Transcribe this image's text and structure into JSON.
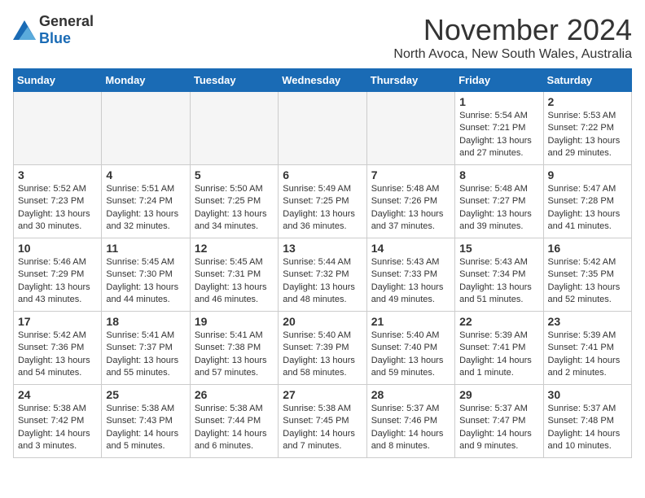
{
  "logo": {
    "text_general": "General",
    "text_blue": "Blue"
  },
  "header": {
    "month": "November 2024",
    "location": "North Avoca, New South Wales, Australia"
  },
  "weekdays": [
    "Sunday",
    "Monday",
    "Tuesday",
    "Wednesday",
    "Thursday",
    "Friday",
    "Saturday"
  ],
  "weeks": [
    [
      {
        "day": "",
        "info": ""
      },
      {
        "day": "",
        "info": ""
      },
      {
        "day": "",
        "info": ""
      },
      {
        "day": "",
        "info": ""
      },
      {
        "day": "",
        "info": ""
      },
      {
        "day": "1",
        "info": "Sunrise: 5:54 AM\nSunset: 7:21 PM\nDaylight: 13 hours and 27 minutes."
      },
      {
        "day": "2",
        "info": "Sunrise: 5:53 AM\nSunset: 7:22 PM\nDaylight: 13 hours and 29 minutes."
      }
    ],
    [
      {
        "day": "3",
        "info": "Sunrise: 5:52 AM\nSunset: 7:23 PM\nDaylight: 13 hours and 30 minutes."
      },
      {
        "day": "4",
        "info": "Sunrise: 5:51 AM\nSunset: 7:24 PM\nDaylight: 13 hours and 32 minutes."
      },
      {
        "day": "5",
        "info": "Sunrise: 5:50 AM\nSunset: 7:25 PM\nDaylight: 13 hours and 34 minutes."
      },
      {
        "day": "6",
        "info": "Sunrise: 5:49 AM\nSunset: 7:25 PM\nDaylight: 13 hours and 36 minutes."
      },
      {
        "day": "7",
        "info": "Sunrise: 5:48 AM\nSunset: 7:26 PM\nDaylight: 13 hours and 37 minutes."
      },
      {
        "day": "8",
        "info": "Sunrise: 5:48 AM\nSunset: 7:27 PM\nDaylight: 13 hours and 39 minutes."
      },
      {
        "day": "9",
        "info": "Sunrise: 5:47 AM\nSunset: 7:28 PM\nDaylight: 13 hours and 41 minutes."
      }
    ],
    [
      {
        "day": "10",
        "info": "Sunrise: 5:46 AM\nSunset: 7:29 PM\nDaylight: 13 hours and 43 minutes."
      },
      {
        "day": "11",
        "info": "Sunrise: 5:45 AM\nSunset: 7:30 PM\nDaylight: 13 hours and 44 minutes."
      },
      {
        "day": "12",
        "info": "Sunrise: 5:45 AM\nSunset: 7:31 PM\nDaylight: 13 hours and 46 minutes."
      },
      {
        "day": "13",
        "info": "Sunrise: 5:44 AM\nSunset: 7:32 PM\nDaylight: 13 hours and 48 minutes."
      },
      {
        "day": "14",
        "info": "Sunrise: 5:43 AM\nSunset: 7:33 PM\nDaylight: 13 hours and 49 minutes."
      },
      {
        "day": "15",
        "info": "Sunrise: 5:43 AM\nSunset: 7:34 PM\nDaylight: 13 hours and 51 minutes."
      },
      {
        "day": "16",
        "info": "Sunrise: 5:42 AM\nSunset: 7:35 PM\nDaylight: 13 hours and 52 minutes."
      }
    ],
    [
      {
        "day": "17",
        "info": "Sunrise: 5:42 AM\nSunset: 7:36 PM\nDaylight: 13 hours and 54 minutes."
      },
      {
        "day": "18",
        "info": "Sunrise: 5:41 AM\nSunset: 7:37 PM\nDaylight: 13 hours and 55 minutes."
      },
      {
        "day": "19",
        "info": "Sunrise: 5:41 AM\nSunset: 7:38 PM\nDaylight: 13 hours and 57 minutes."
      },
      {
        "day": "20",
        "info": "Sunrise: 5:40 AM\nSunset: 7:39 PM\nDaylight: 13 hours and 58 minutes."
      },
      {
        "day": "21",
        "info": "Sunrise: 5:40 AM\nSunset: 7:40 PM\nDaylight: 13 hours and 59 minutes."
      },
      {
        "day": "22",
        "info": "Sunrise: 5:39 AM\nSunset: 7:41 PM\nDaylight: 14 hours and 1 minute."
      },
      {
        "day": "23",
        "info": "Sunrise: 5:39 AM\nSunset: 7:41 PM\nDaylight: 14 hours and 2 minutes."
      }
    ],
    [
      {
        "day": "24",
        "info": "Sunrise: 5:38 AM\nSunset: 7:42 PM\nDaylight: 14 hours and 3 minutes."
      },
      {
        "day": "25",
        "info": "Sunrise: 5:38 AM\nSunset: 7:43 PM\nDaylight: 14 hours and 5 minutes."
      },
      {
        "day": "26",
        "info": "Sunrise: 5:38 AM\nSunset: 7:44 PM\nDaylight: 14 hours and 6 minutes."
      },
      {
        "day": "27",
        "info": "Sunrise: 5:38 AM\nSunset: 7:45 PM\nDaylight: 14 hours and 7 minutes."
      },
      {
        "day": "28",
        "info": "Sunrise: 5:37 AM\nSunset: 7:46 PM\nDaylight: 14 hours and 8 minutes."
      },
      {
        "day": "29",
        "info": "Sunrise: 5:37 AM\nSunset: 7:47 PM\nDaylight: 14 hours and 9 minutes."
      },
      {
        "day": "30",
        "info": "Sunrise: 5:37 AM\nSunset: 7:48 PM\nDaylight: 14 hours and 10 minutes."
      }
    ]
  ]
}
